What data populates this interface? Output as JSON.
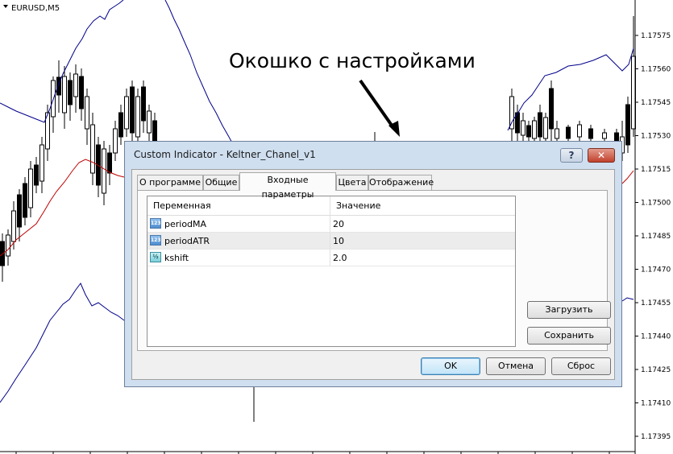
{
  "chart": {
    "symbol": "EURUSD,M5",
    "price_axis": [
      "1.17575",
      "1.17560",
      "1.17545",
      "1.17530",
      "1.17515",
      "1.17500",
      "1.17485",
      "1.17470",
      "1.17455",
      "1.17440",
      "1.17425",
      "1.17410",
      "1.17395"
    ],
    "colors": {
      "background": "#ffffff",
      "channel": "#00008b",
      "middle_line": "#c00000",
      "candles": "#000000"
    }
  },
  "annotation": {
    "text": "Окошко с настройками"
  },
  "dialog": {
    "title": "Custom Indicator - Keltner_Chanel_v1",
    "help_label": "?",
    "close_label": "✕",
    "tabs": [
      {
        "label": "О программе",
        "active": false
      },
      {
        "label": "Общие",
        "active": false
      },
      {
        "label": "Входные параметры",
        "active": true
      },
      {
        "label": "Цвета",
        "active": false
      },
      {
        "label": "Отображение",
        "active": false
      }
    ],
    "params_table": {
      "headers": {
        "variable": "Переменная",
        "value": "Значение"
      },
      "rows": [
        {
          "icon": "int-type-icon",
          "icon_text": "123",
          "name": "periodMA",
          "value": "20"
        },
        {
          "icon": "int-type-icon",
          "icon_text": "123",
          "name": "periodATR",
          "value": "10"
        },
        {
          "icon": "double-type-icon",
          "icon_text": "½",
          "name": "kshift",
          "value": "2.0"
        }
      ]
    },
    "buttons": {
      "load": "Загрузить",
      "save": "Сохранить",
      "ok": "OK",
      "cancel": "Отмена",
      "reset": "Сброс"
    }
  }
}
